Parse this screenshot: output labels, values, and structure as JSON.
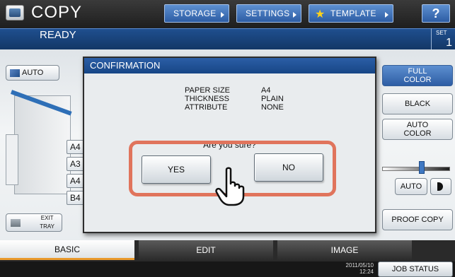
{
  "header": {
    "title": "COPY",
    "status": "READY",
    "set_label": "SET",
    "set_count": "1",
    "buttons": {
      "storage": "STORAGE",
      "settings": "SETTINGS",
      "template": "TEMPLATE",
      "help": "?"
    }
  },
  "left_panel": {
    "auto_label": "AUTO",
    "exit_tray_label": "EXIT\nTRAY",
    "paper_sizes": [
      "A4",
      "A3",
      "A4",
      "B4"
    ]
  },
  "right_panel": {
    "full_color": "FULL\nCOLOR",
    "black": "BLACK",
    "auto_color": "AUTO\nCOLOR",
    "auto_density": "AUTO",
    "proof_copy": "PROOF COPY"
  },
  "dialog": {
    "title": "CONFIRMATION",
    "labels": [
      "PAPER SIZE",
      "THICKNESS",
      "ATTRIBUTE"
    ],
    "values": [
      "A4",
      "PLAIN",
      "NONE"
    ],
    "question": "Are you sure?",
    "yes_label": "YES",
    "no_label": "NO"
  },
  "tabs": {
    "basic": "BASIC",
    "edit": "EDIT",
    "image": "IMAGE"
  },
  "footer": {
    "date": "2011/05/10",
    "time": "12:24",
    "job_status": "JOB STATUS"
  },
  "colors": {
    "accent_blue": "#2b5ea6",
    "highlight": "#e0745c",
    "tab_underline": "#e99a2c"
  }
}
